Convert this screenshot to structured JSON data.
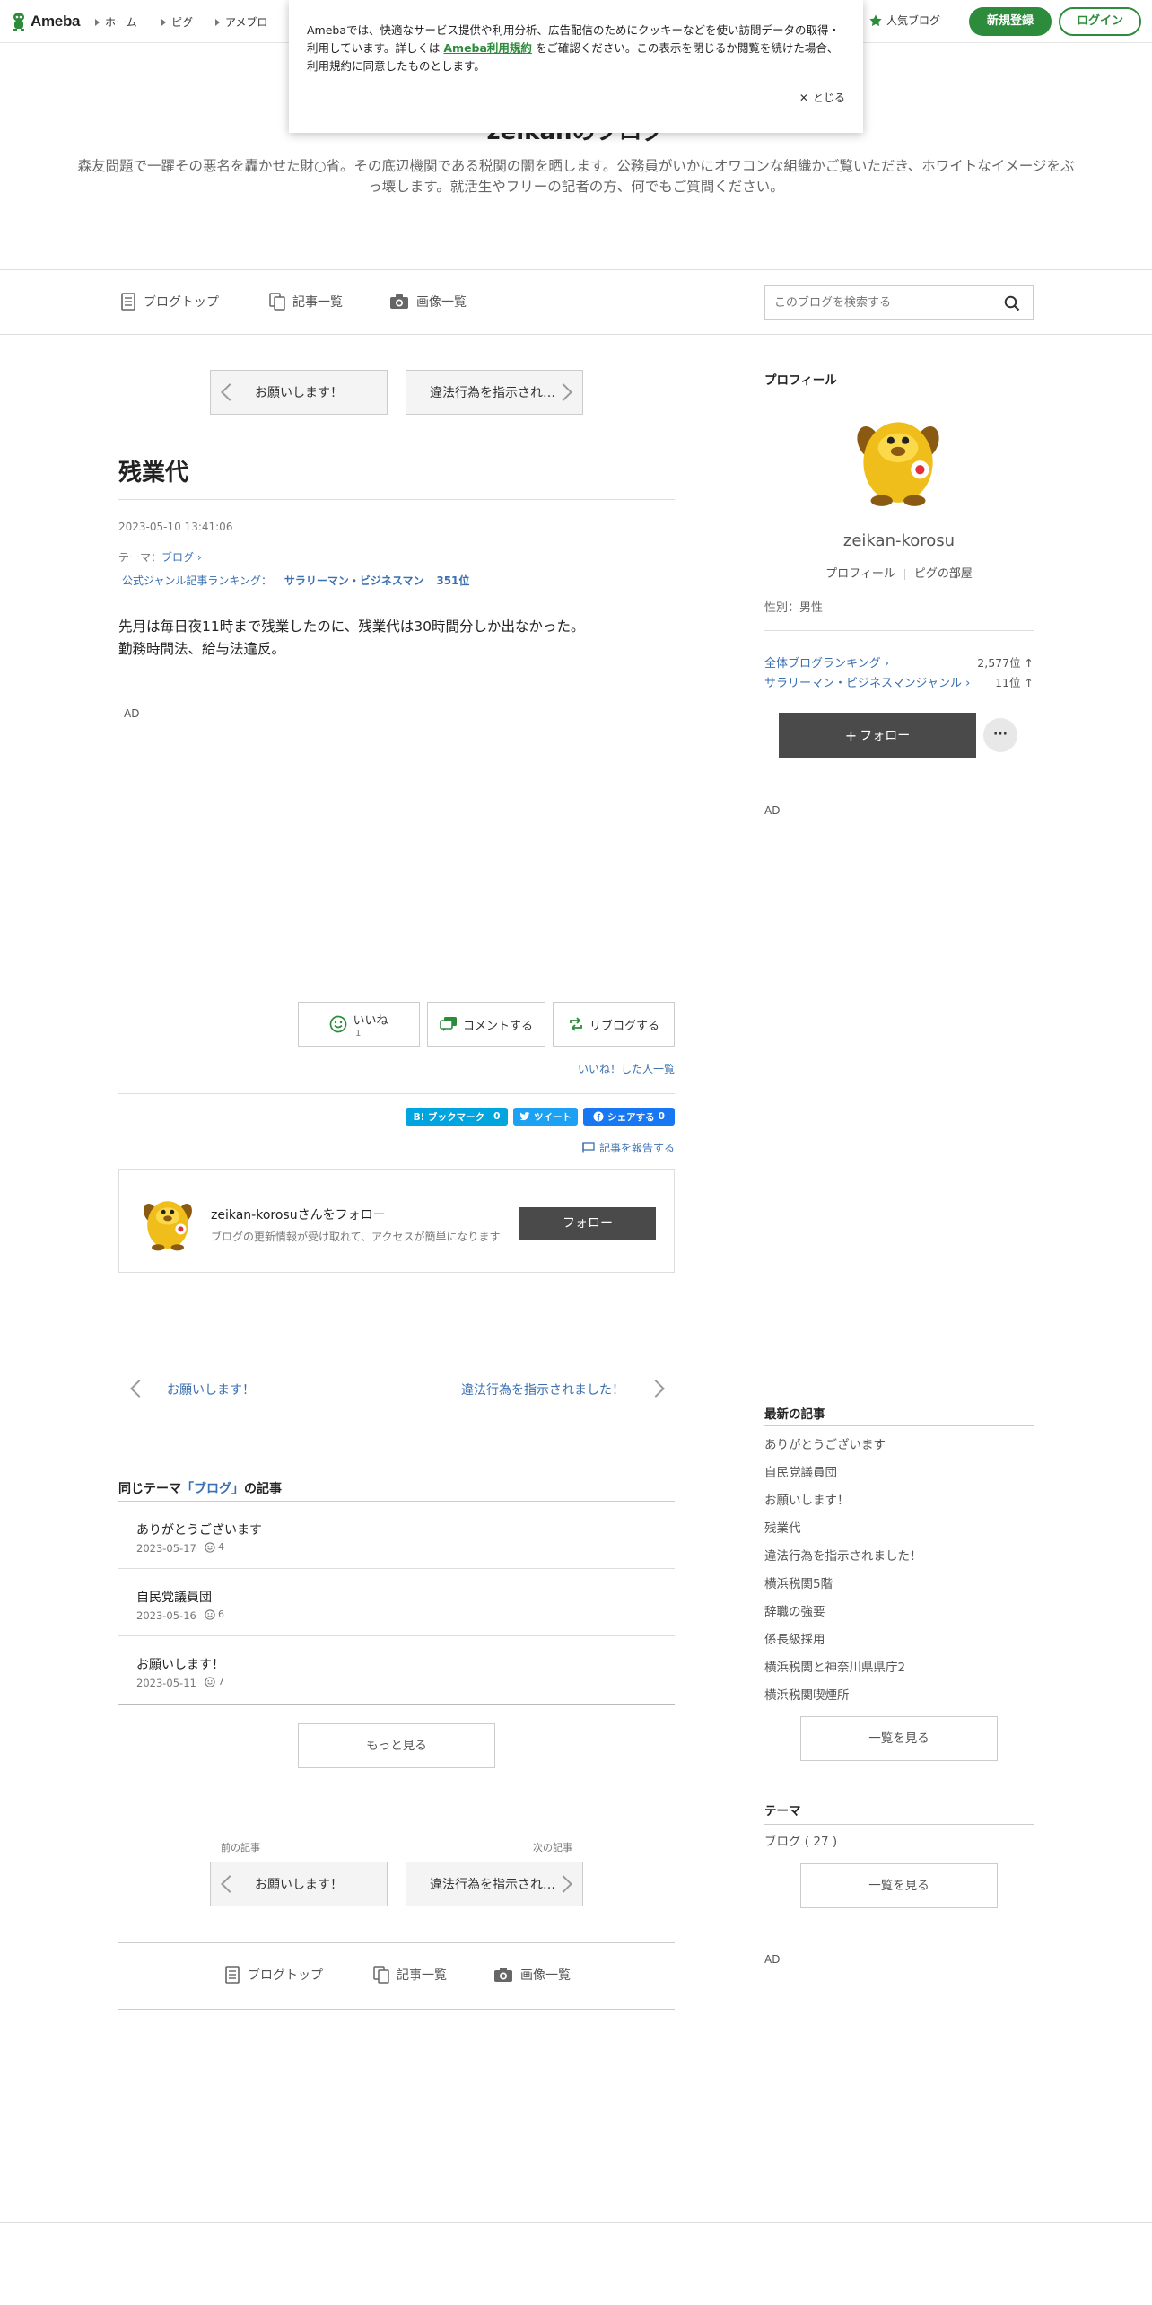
{
  "topbar": {
    "logo_text": "Ameba",
    "nav": [
      "ホーム",
      "ピグ",
      "アメブロ"
    ],
    "popular_blog": "人気ブログ",
    "signup": "新規登録",
    "login": "ログイン",
    "brand_color": "#2d8c3c"
  },
  "cookie": {
    "text_before": "Amebaでは、快適なサービス提供や利用分析、広告配信のためにクッキーなどを使い訪問データの取得・利用しています。詳しくは",
    "terms_link": "Ameba利用規約",
    "text_after": "をご確認ください。この表示を閉じるか閲覧を続けた場合、利用規約に同意したものとします。",
    "close": "とじる"
  },
  "header": {
    "title": "zeikanのブログ",
    "description": "森友問題で一躍その悪名を轟かせた財○省。その底辺機関である税関の闇を晒します。公務員がいかにオワコンな組織かご覧いただき、ホワイトなイメージをぶっ壊します。就活生やフリーの記者の方、何でもご質問ください。"
  },
  "blognav": {
    "top": "ブログトップ",
    "list": "記事一覧",
    "images": "画像一覧"
  },
  "search": {
    "placeholder": "このブログを検索する"
  },
  "pager": {
    "prev_title": "お願いします！",
    "next_title": "違法行為を指示されました！",
    "prev_label": "前の記事",
    "next_label": "次の記事"
  },
  "article": {
    "title": "残業代",
    "date": "2023-05-10 13:41:06",
    "theme_prefix": "テーマ：",
    "theme": "ブログ",
    "ranking_prefix": "公式ジャンル記事ランキング：",
    "ranking_genre": "サラリーマン・ビジネスマン",
    "ranking_value": "351位",
    "body": [
      "先月は毎日夜11時まで残業したのに、残業代は30時間分しか出なかった。",
      "勤務時間法、給与法違反。"
    ],
    "ad": "AD"
  },
  "reactions": {
    "like": "いいね",
    "like_count": "1",
    "comment": "コメントする",
    "reblog": "リブログする",
    "liked_list": "いいね！した人一覧"
  },
  "share": {
    "hatena": "B! ブックマーク",
    "hatena_count": "0",
    "tweet": "ツイート",
    "facebook": "シェアする",
    "facebook_count": "0",
    "report": "記事を報告する"
  },
  "follow_card": {
    "name": "zeikan-korosuさんをフォロー",
    "desc": "ブログの更新情報が受け取れて、アクセスが簡単になります",
    "button": "フォロー"
  },
  "prevnext": {
    "prev": "お願いします！",
    "next": "違法行為を指示されました！"
  },
  "same_theme": {
    "heading_before": "同じテーマ",
    "heading_theme": "「ブログ」",
    "heading_after": "の記事",
    "items": [
      {
        "title": "ありがとうございます",
        "date": "2023-05-17",
        "likes": "4"
      },
      {
        "title": "自民党議員団",
        "date": "2023-05-16",
        "likes": "6"
      },
      {
        "title": "お願いします！",
        "date": "2023-05-11",
        "likes": "7"
      }
    ],
    "more": "もっと見る"
  },
  "sidebar": {
    "profile_heading": "プロフィール",
    "profile_name": "zeikan-korosu",
    "profile_link": "プロフィール",
    "pig_link": "ピグの部屋",
    "gender": "性別：男性",
    "rank_all_label": "全体ブログランキング",
    "rank_all_value": "2,577位 ↑",
    "rank_genre_label": "サラリーマン・ビジネスマンジャンル",
    "rank_genre_value": "11位 ↑",
    "follow": "フォロー",
    "more": "···",
    "ad1": "AD",
    "recent_heading": "最新の記事",
    "recent": [
      "ありがとうございます",
      "自民党議員団",
      "お願いします！",
      "残業代",
      "違法行為を指示されました！",
      "横浜税関5階",
      "辞職の強要",
      "係長級採用",
      "横浜税関と神奈川県県庁2",
      "横浜税関喫煙所"
    ],
    "recent_more": "一覧を見る",
    "theme_heading": "テーマ",
    "theme_item": "ブログ ( 27 )",
    "theme_more": "一覧を見る",
    "ad2": "AD"
  }
}
